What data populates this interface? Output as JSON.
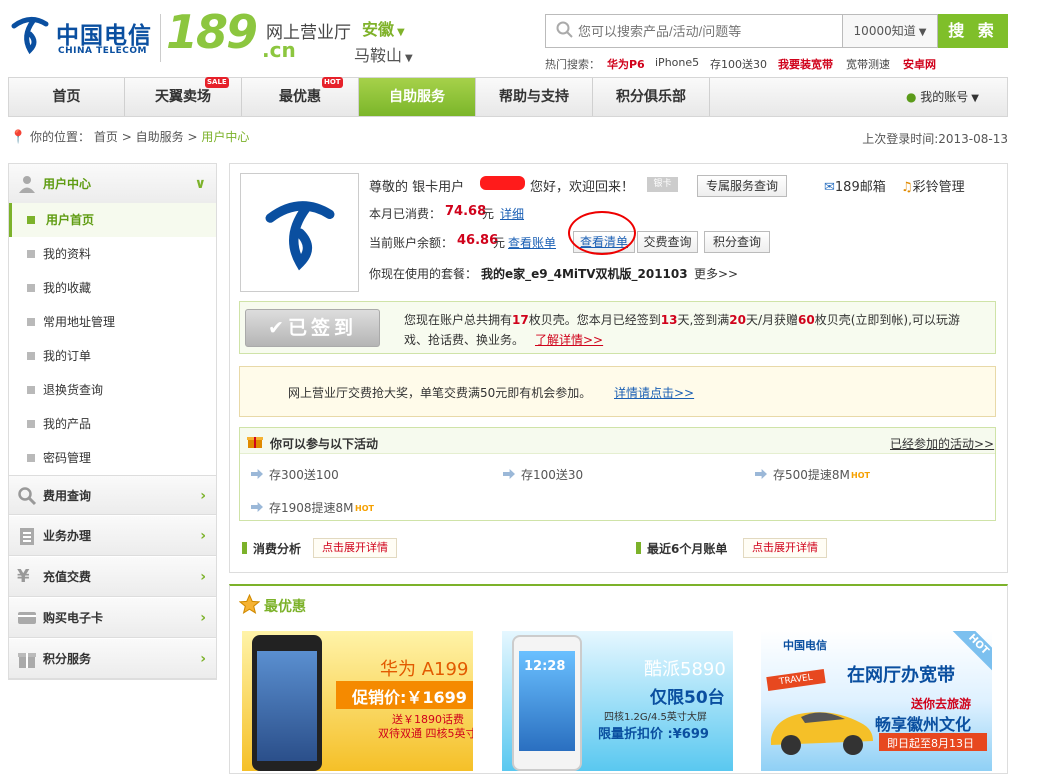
{
  "header": {
    "logo_cn": "中国电信",
    "logo_en": "CHINA TELECOM",
    "logo_189": "189",
    "logo_cn_suffix": ".cn",
    "site_name": "网上营业厅",
    "province": "安徽",
    "city": "马鞍山",
    "search_placeholder": "您可以搜索产品/活动/问题等",
    "zhidao": "10000知道",
    "search_btn": "搜 索",
    "hot_label": "热门搜索：",
    "hot_words": [
      "华为P6",
      "iPhone5",
      "存100送30",
      "我要装宽带",
      "宽带测速",
      "安卓网"
    ]
  },
  "nav": {
    "items": [
      {
        "label": "首页"
      },
      {
        "label": "天翼卖场",
        "badge": "SALE"
      },
      {
        "label": "最优惠",
        "badge": "HOT"
      },
      {
        "label": "自助服务"
      },
      {
        "label": "帮助与支持"
      },
      {
        "label": "积分俱乐部"
      }
    ],
    "account": "我的账号"
  },
  "breadcrumb": {
    "prefix": "你的位置：",
    "items": [
      "首页",
      "自助服务"
    ],
    "current": "用户中心",
    "sep": ">"
  },
  "last_login": "上次登录时间:2013-08-13",
  "sidebar": {
    "head": "用户中心",
    "items": [
      "用户首页",
      "我的资料",
      "我的收藏",
      "常用地址管理",
      "我的订单",
      "退换货查询",
      "我的产品",
      "密码管理"
    ],
    "sections": [
      "费用查询",
      "业务办理",
      "充值交费",
      "购买电子卡",
      "积分服务"
    ]
  },
  "user": {
    "greet_pre": "尊敬的 银卡用户",
    "greet_post": "您好，欢迎回来！",
    "tag": "银卡",
    "exclusive_btn": "专属服务查询",
    "mail": "189邮箱",
    "ring": "彩铃管理",
    "spent_label": "本月已消费：",
    "spent_value": "74.68",
    "yuan": "元",
    "detail": "详细",
    "balance_label": "当前账户余额：",
    "balance_value": "46.86",
    "view_bill": "查看账单",
    "view_list": "查看清单",
    "pay_query": "交费查询",
    "points_query": "积分查询",
    "plan_label": "你现在使用的套餐：",
    "plan_name": "我的e家_e9_4MiTV双机版_201103",
    "more": "更多>>"
  },
  "signin": {
    "btn": "已签到",
    "t1": "您现在账户总共拥有",
    "n1": "17",
    "t2": "枚贝壳。您本月已经签到",
    "n2": "13",
    "t3": "天,签到满",
    "n3": "20",
    "t4": "天/月获赠",
    "n4": "60",
    "t5": "枚贝壳(立即到帐),可以玩游",
    "line2": "戏、抢话费、换业务。",
    "link": "了解详情>>"
  },
  "promo": {
    "text": "网上营业厅交费抢大奖，单笔交费满50元即有机会参加。",
    "link": "详情请点击>>"
  },
  "activities": {
    "title": "你可以参与以下活动",
    "joined": "已经参加的活动>>",
    "items": [
      {
        "label": "存300送100",
        "hot": ""
      },
      {
        "label": "存100送30",
        "hot": ""
      },
      {
        "label": "存500提速8M",
        "hot": "HOT"
      },
      {
        "label": "存1908提速8M",
        "hot": "HOT"
      }
    ]
  },
  "analysis": {
    "consume": "消费分析",
    "bills": "最近6个月账单",
    "expand": "点击展开详情"
  },
  "deals": {
    "title": "最优惠",
    "cards": [
      {
        "name": "华为 A199",
        "price": "促销价:￥1699",
        "sub": "送￥1890话费",
        "sub2": "双待双通 四核5英寸"
      },
      {
        "name": "酷派5890",
        "price": "仅限50台",
        "sub": "四核1.2G/4.5英寸大屏",
        "sub2": "限量折扣价 :¥699",
        "clock": "12:28"
      },
      {
        "logo": "中国电信",
        "hot": "HOT",
        "title": "在网厅办宽带",
        "sub": "送你去旅游",
        "sub2": "畅享徽州文化",
        "date": "即日起至8月13日",
        "travel": "TRAVEL"
      }
    ]
  },
  "colors": {
    "green": "#7cb22a",
    "blue": "#0a4fa0",
    "red": "#d0021b"
  }
}
